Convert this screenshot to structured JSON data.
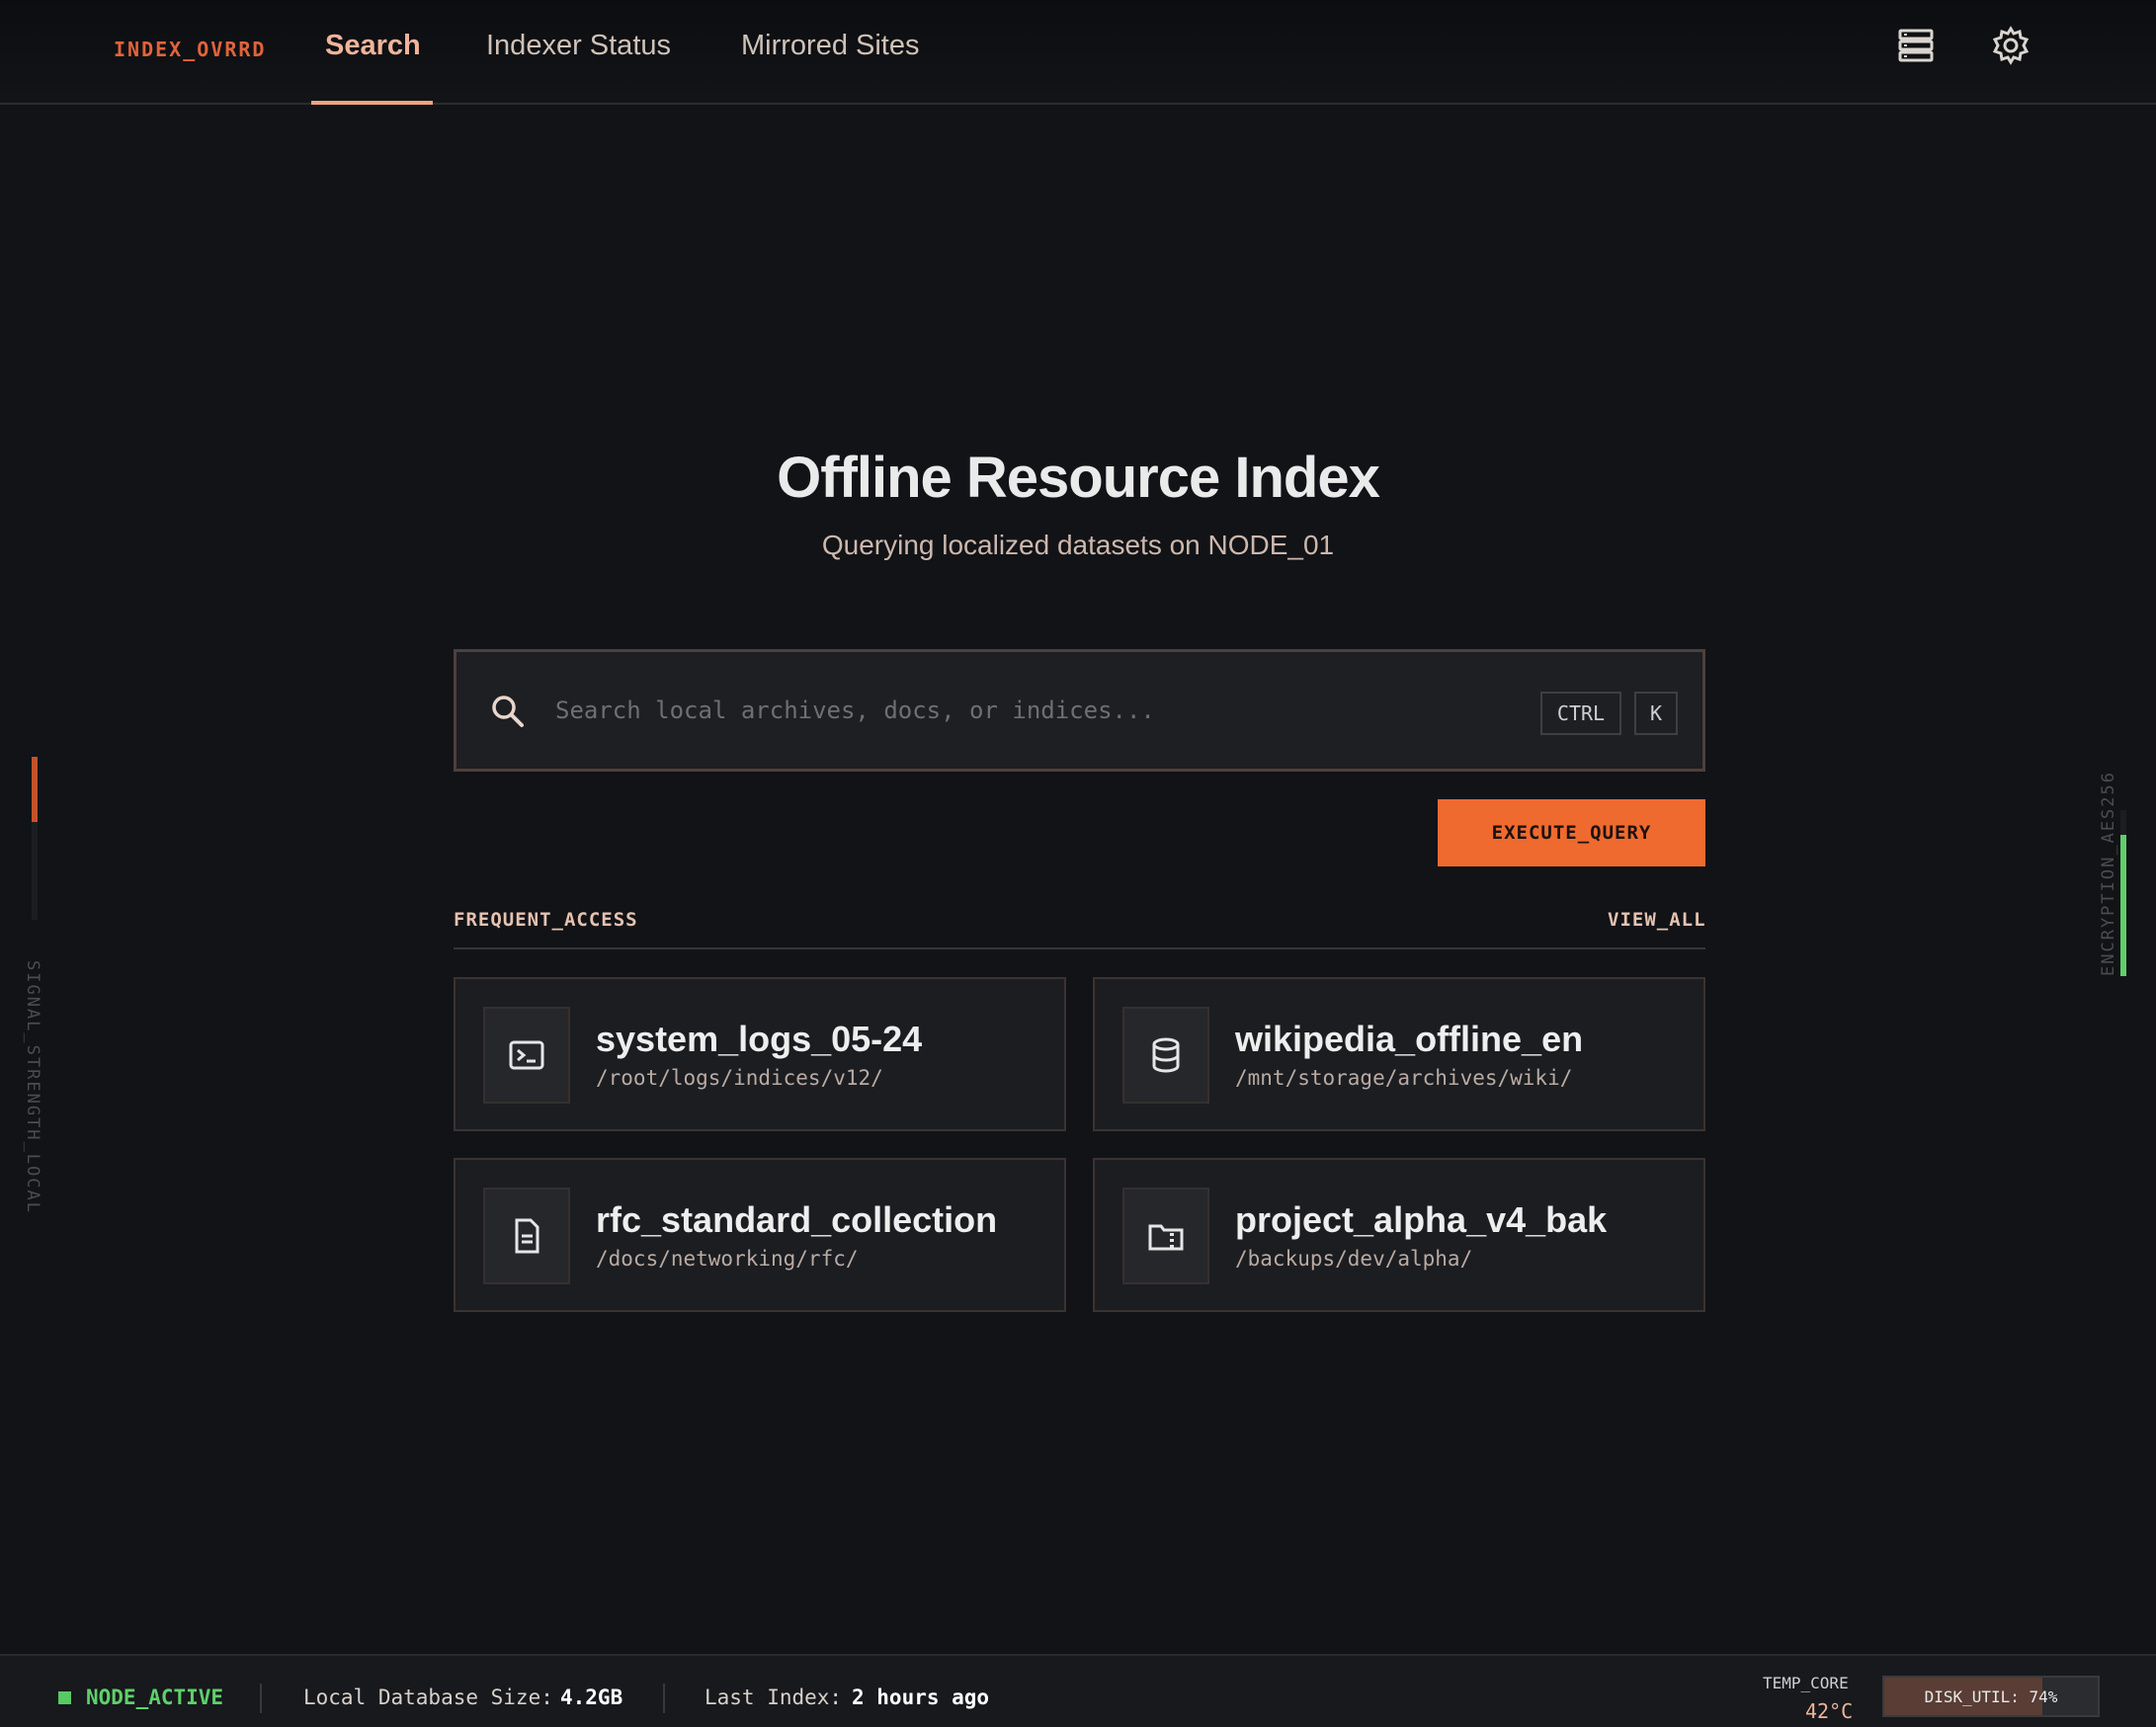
{
  "header": {
    "brand": "INDEX_OVRRD",
    "tabs": [
      {
        "label": "Search",
        "active": true
      },
      {
        "label": "Indexer Status",
        "active": false
      },
      {
        "label": "Mirrored Sites",
        "active": false
      }
    ],
    "icons": [
      "storage-list-icon",
      "settings-gear-icon"
    ]
  },
  "hero": {
    "title": "Offline Resource Index",
    "subtitle": "Querying localized datasets on NODE_01"
  },
  "search": {
    "placeholder": "Search local archives, docs, or indices...",
    "value": "",
    "shortcut_keys": [
      "CTRL",
      "K"
    ],
    "execute_label": "EXECUTE_QUERY"
  },
  "frequent": {
    "label": "FREQUENT_ACCESS",
    "view_all": "VIEW_ALL",
    "items": [
      {
        "title": "system_logs_05-24",
        "path": "/root/logs/indices/v12/",
        "icon": "terminal-icon"
      },
      {
        "title": "wikipedia_offline_en",
        "path": "/mnt/storage/archives/wiki/",
        "icon": "database-icon"
      },
      {
        "title": "rfc_standard_collection",
        "path": "/docs/networking/rfc/",
        "icon": "document-icon"
      },
      {
        "title": "project_alpha_v4_bak",
        "path": "/backups/dev/alpha/",
        "icon": "archive-folder-icon"
      }
    ]
  },
  "side": {
    "left_label": "SIGNAL_STRENGTH_LOCAL",
    "right_label": "ENCRYPTION_AES256"
  },
  "footer": {
    "status": "NODE_ACTIVE",
    "db_size_label": "Local Database Size:",
    "db_size_value": "4.2GB",
    "last_index_label": "Last Index:",
    "last_index_value": "2 hours ago",
    "temp_label": "TEMP_CORE",
    "temp_value": "42°C",
    "disk_label": "DISK_UTIL: 74%",
    "disk_util_percent": 74
  },
  "colors": {
    "accent": "#ef6a2f",
    "brand": "#e0643a",
    "status_ok": "#58c964",
    "background": "#111317"
  }
}
